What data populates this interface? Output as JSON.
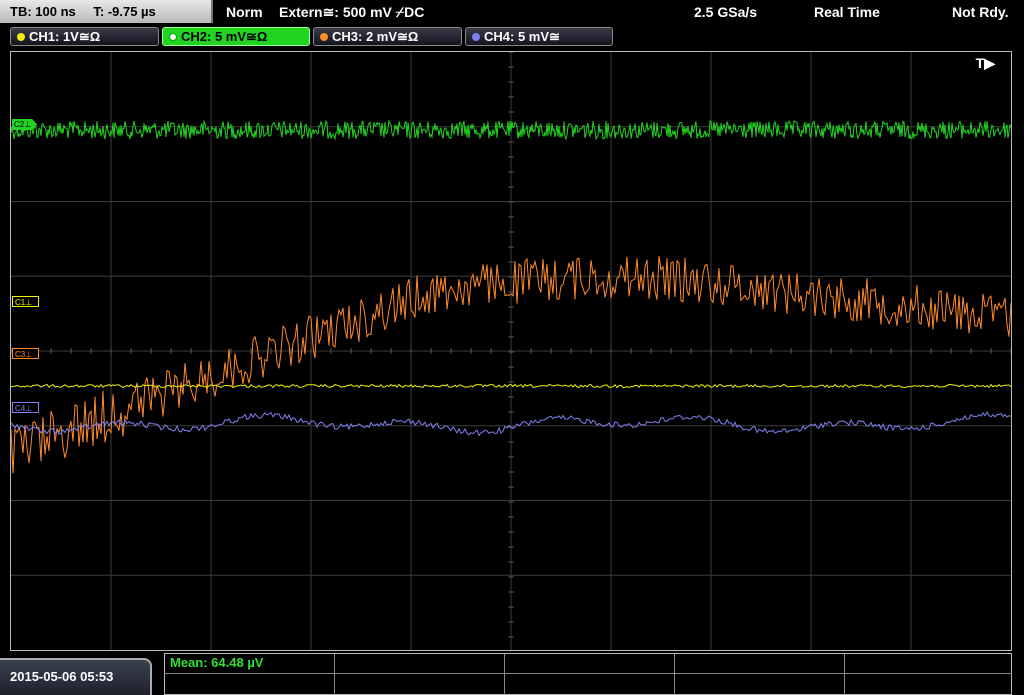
{
  "status": {
    "timebase": "TB: 100 ns",
    "trigger_offset": "T: -9.75 µs",
    "trigger_mode": "Norm",
    "trigger_source": "Extern≅: 500 mV ⌿DC",
    "sample_rate": "2.5 GSa/s",
    "acq_mode": "Real Time",
    "state": "Not Rdy."
  },
  "channels": [
    {
      "label": "CH1: 1V≅Ω",
      "color": "#f0f000",
      "marker": "C1⊥"
    },
    {
      "label": "CH2: 5 mV≅Ω",
      "color": "#22d322",
      "marker": "C2⊥"
    },
    {
      "label": "CH3: 2 mV≅Ω",
      "color": "#ff8a2a",
      "marker": "C3⊥"
    },
    {
      "label": "CH4: 5 mV≅",
      "color": "#8080f0",
      "marker": "C4⊥"
    }
  ],
  "trigger_marker": "T▶",
  "measurement": {
    "mean": "Mean: 64.48 µV"
  },
  "datetime": "2015-05-06 05:53"
}
